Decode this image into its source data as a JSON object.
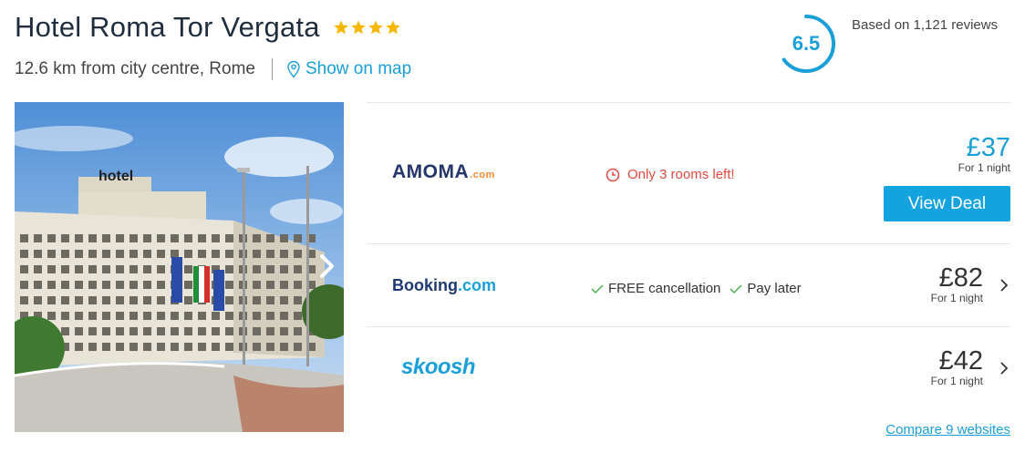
{
  "hotel": {
    "name": "Hotel Roma Tor Vergata",
    "stars": 4,
    "distance": "12.6 km from city centre, Rome",
    "map_link": "Show on map"
  },
  "rating": {
    "score": "6.5",
    "score_fraction": 0.65,
    "reviews": "Based on 1,121 reviews"
  },
  "photo": {
    "sign_text": "hotel"
  },
  "deals": [
    {
      "provider": "AMOMA.com",
      "logo_main": "AMOMA",
      "logo_suffix": ".com",
      "note": "Only 3 rooms left!",
      "price": "£37",
      "per_night": "For 1 night",
      "cta": "View Deal"
    },
    {
      "provider": "Booking.com",
      "logo_main": "Booking",
      "logo_suffix": ".com",
      "features": [
        "FREE cancellation",
        "Pay later"
      ],
      "price": "£82",
      "per_night": "For 1 night"
    },
    {
      "provider": "skoosh",
      "logo_main": "skoosh",
      "price": "£42",
      "per_night": "For 1 night"
    }
  ],
  "compare_link": "Compare 9 websites",
  "colors": {
    "accent": "#1a9fd8",
    "button": "#13a4e0",
    "alert": "#e04a40",
    "check": "#4caf50",
    "star": "#f5b800",
    "title": "#1f2d3d"
  }
}
